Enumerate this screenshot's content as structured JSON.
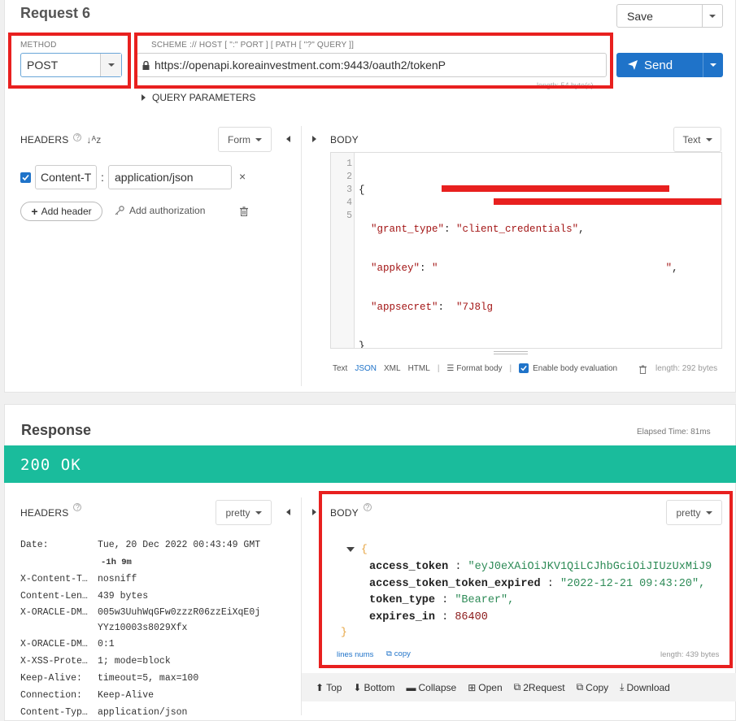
{
  "request": {
    "title": "Request 6",
    "save_label": "Save",
    "method_label": "METHOD",
    "method_value": "POST",
    "url_label": "SCHEME :// HOST [ \":\" PORT ] [ PATH [ \"?\" QUERY ]]",
    "url_value": "https://openapi.koreainvestment.com:9443/oauth2/tokenP",
    "url_length": "length: 54 byte(s)",
    "send_label": "Send",
    "query_params_label": "QUERY PARAMETERS",
    "headers_title": "HEADERS",
    "headers_mode": "Form",
    "header_name": "Content-T",
    "header_value": "application/json",
    "add_header_label": "Add header",
    "add_auth_label": "Add authorization",
    "body_title": "BODY",
    "body_mode": "Text",
    "body_lines": [
      "1",
      "2",
      "3",
      "4",
      "5"
    ],
    "body_code": {
      "open": "{",
      "k1": "\"grant_type\"",
      "v1": "\"client_credentials\"",
      "k2": "\"appkey\"",
      "v2a": "\"",
      "v2b": "\"",
      "k3": "\"appsecret\"",
      "v3": "\"7J8lg",
      "close": "}"
    },
    "body_formats": [
      "Text",
      "JSON",
      "XML",
      "HTML"
    ],
    "format_body_label": "Format body",
    "enable_eval_label": "Enable body evaluation",
    "body_length": "length: 292 bytes"
  },
  "response": {
    "title": "Response",
    "elapsed": "Elapsed Time: 81ms",
    "status": "200 OK",
    "status_color": "#1abc9c",
    "headers_title": "HEADERS",
    "headers_mode": "pretty",
    "headers": [
      {
        "k": "Date:",
        "v": "Tue, 20 Dec 2022 00:43:49 GMT",
        "v2": "-1h 9m"
      },
      {
        "k": "X-Content-T…",
        "v": "nosniff"
      },
      {
        "k": "Content-Len…",
        "v": "439 bytes"
      },
      {
        "k": "X-ORACLE-DM…",
        "v": "005w3UuhWqGFw0zzzR06zzEiXqE0j",
        "v2": "YYz10003s8029Xfx"
      },
      {
        "k": "X-ORACLE-DM…",
        "v": "0:1"
      },
      {
        "k": "X-XSS-Prote…",
        "v": "1; mode=block"
      },
      {
        "k": "Keep-Alive:",
        "v": "timeout=5, max=100"
      },
      {
        "k": "Connection:",
        "v": "Keep-Alive"
      },
      {
        "k": "Content-Typ…",
        "v": "application/json"
      }
    ],
    "body_title": "BODY",
    "body_mode": "pretty",
    "json": {
      "open": "{",
      "close": "}",
      "fields": [
        {
          "k": "access_token",
          "v": "\"eyJ0eXAiOiJKV1QiLCJhbGciOiJIUzUxMiJ9"
        },
        {
          "k": "access_token_token_expired",
          "v": "\"2022-12-21 09:43:20\","
        },
        {
          "k": "token_type",
          "v": "\"Bearer\","
        },
        {
          "k": "expires_in",
          "v": "86400"
        }
      ]
    },
    "lines_nums_label": "lines nums",
    "copy_label": "copy",
    "body_length": "length: 439 bytes",
    "actions": [
      "Top",
      "Bottom",
      "Collapse",
      "Open",
      "2Request",
      "Copy",
      "Download"
    ]
  }
}
